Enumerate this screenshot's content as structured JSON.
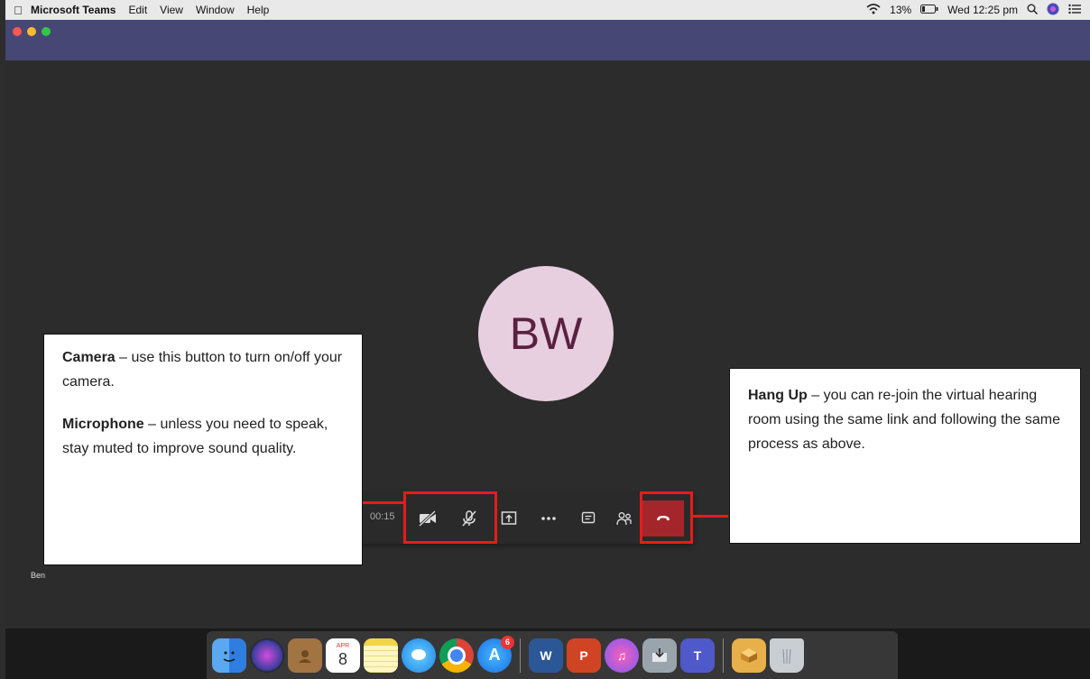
{
  "menubar": {
    "app_name": "Microsoft Teams",
    "items": [
      "Edit",
      "View",
      "Window",
      "Help"
    ],
    "battery": "13%",
    "clock": "Wed 12:25 pm"
  },
  "meeting": {
    "avatar_initials": "BW",
    "timer": "00:15",
    "participant_name": "Ben"
  },
  "callouts": {
    "camera_title": "Camera",
    "camera_text": " – use this button to turn on/off your camera.",
    "mic_title": "Microphone",
    "mic_text": " – unless you need to speak, stay muted to improve sound quality.",
    "hangup_title": "Hang Up",
    "hangup_text": " – you can re-join the virtual hearing room using the same link and following the same process as above."
  },
  "dock": {
    "calendar_month": "APR",
    "calendar_day": "8",
    "appstore_badge": "6",
    "items": [
      "finder-icon",
      "siri-icon",
      "contacts-icon",
      "calendar-icon",
      "notes-icon",
      "messages-icon",
      "chrome-icon",
      "appstore-icon",
      "word-icon",
      "powerpoint-icon",
      "itunes-icon",
      "installer-icon",
      "teams-icon",
      "archive-icon",
      "trash-icon"
    ]
  },
  "colors": {
    "teams_header": "#464775",
    "hangup": "#a4262c",
    "annotation_red": "#e81b1b",
    "avatar_bg": "#e7cfe0"
  }
}
